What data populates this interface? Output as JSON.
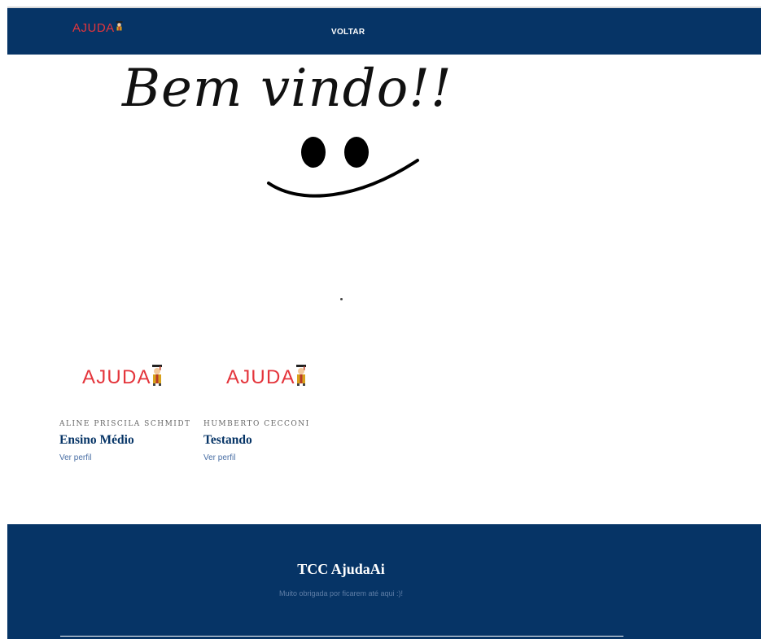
{
  "header": {
    "logo_text": "AJUDA",
    "logo_icon": "graduate-mascot-icon",
    "back_label": "VOLTAR"
  },
  "welcome": {
    "text": "Bem vindo!!",
    "icon": "smiley-face-icon"
  },
  "cards": [
    {
      "logo_text": "AJUDA",
      "logo_icon": "graduate-mascot-icon",
      "author": "ALINE PRISCILA SCHMIDT",
      "title": "Ensino Médio",
      "link": "Ver perfil"
    },
    {
      "logo_text": "AJUDA",
      "logo_icon": "graduate-mascot-icon",
      "author": "HUMBERTO CECCONI",
      "title": "Testando",
      "link": "Ver perfil"
    }
  ],
  "footer": {
    "title": "TCC AjudaAi",
    "subtitle": "Muito obrigada por ficarem até aqui :)!"
  },
  "colors": {
    "brand_navy": "#063466",
    "logo_red": "#e4353c",
    "link_blue": "#4a6fa5"
  }
}
